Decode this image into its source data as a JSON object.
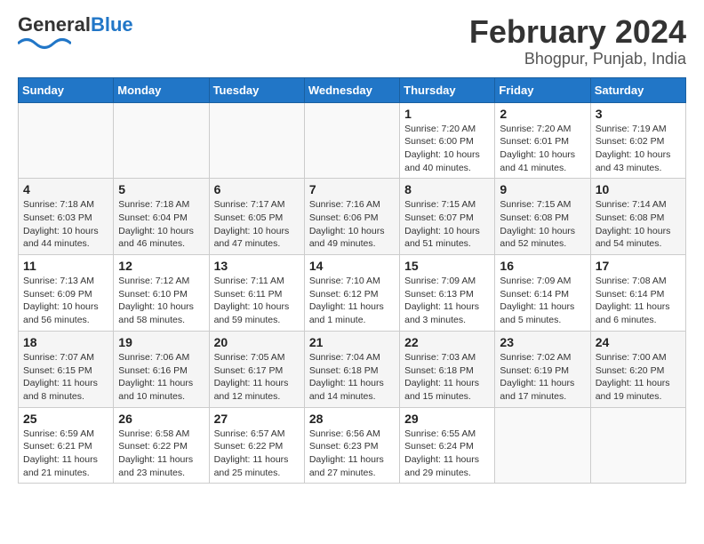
{
  "logo": {
    "general": "General",
    "blue": "Blue"
  },
  "title": "February 2024",
  "subtitle": "Bhogpur, Punjab, India",
  "days_of_week": [
    "Sunday",
    "Monday",
    "Tuesday",
    "Wednesday",
    "Thursday",
    "Friday",
    "Saturday"
  ],
  "weeks": [
    [
      {
        "num": "",
        "info": ""
      },
      {
        "num": "",
        "info": ""
      },
      {
        "num": "",
        "info": ""
      },
      {
        "num": "",
        "info": ""
      },
      {
        "num": "1",
        "info": "Sunrise: 7:20 AM\nSunset: 6:00 PM\nDaylight: 10 hours\nand 40 minutes."
      },
      {
        "num": "2",
        "info": "Sunrise: 7:20 AM\nSunset: 6:01 PM\nDaylight: 10 hours\nand 41 minutes."
      },
      {
        "num": "3",
        "info": "Sunrise: 7:19 AM\nSunset: 6:02 PM\nDaylight: 10 hours\nand 43 minutes."
      }
    ],
    [
      {
        "num": "4",
        "info": "Sunrise: 7:18 AM\nSunset: 6:03 PM\nDaylight: 10 hours\nand 44 minutes."
      },
      {
        "num": "5",
        "info": "Sunrise: 7:18 AM\nSunset: 6:04 PM\nDaylight: 10 hours\nand 46 minutes."
      },
      {
        "num": "6",
        "info": "Sunrise: 7:17 AM\nSunset: 6:05 PM\nDaylight: 10 hours\nand 47 minutes."
      },
      {
        "num": "7",
        "info": "Sunrise: 7:16 AM\nSunset: 6:06 PM\nDaylight: 10 hours\nand 49 minutes."
      },
      {
        "num": "8",
        "info": "Sunrise: 7:15 AM\nSunset: 6:07 PM\nDaylight: 10 hours\nand 51 minutes."
      },
      {
        "num": "9",
        "info": "Sunrise: 7:15 AM\nSunset: 6:08 PM\nDaylight: 10 hours\nand 52 minutes."
      },
      {
        "num": "10",
        "info": "Sunrise: 7:14 AM\nSunset: 6:08 PM\nDaylight: 10 hours\nand 54 minutes."
      }
    ],
    [
      {
        "num": "11",
        "info": "Sunrise: 7:13 AM\nSunset: 6:09 PM\nDaylight: 10 hours\nand 56 minutes."
      },
      {
        "num": "12",
        "info": "Sunrise: 7:12 AM\nSunset: 6:10 PM\nDaylight: 10 hours\nand 58 minutes."
      },
      {
        "num": "13",
        "info": "Sunrise: 7:11 AM\nSunset: 6:11 PM\nDaylight: 10 hours\nand 59 minutes."
      },
      {
        "num": "14",
        "info": "Sunrise: 7:10 AM\nSunset: 6:12 PM\nDaylight: 11 hours\nand 1 minute."
      },
      {
        "num": "15",
        "info": "Sunrise: 7:09 AM\nSunset: 6:13 PM\nDaylight: 11 hours\nand 3 minutes."
      },
      {
        "num": "16",
        "info": "Sunrise: 7:09 AM\nSunset: 6:14 PM\nDaylight: 11 hours\nand 5 minutes."
      },
      {
        "num": "17",
        "info": "Sunrise: 7:08 AM\nSunset: 6:14 PM\nDaylight: 11 hours\nand 6 minutes."
      }
    ],
    [
      {
        "num": "18",
        "info": "Sunrise: 7:07 AM\nSunset: 6:15 PM\nDaylight: 11 hours\nand 8 minutes."
      },
      {
        "num": "19",
        "info": "Sunrise: 7:06 AM\nSunset: 6:16 PM\nDaylight: 11 hours\nand 10 minutes."
      },
      {
        "num": "20",
        "info": "Sunrise: 7:05 AM\nSunset: 6:17 PM\nDaylight: 11 hours\nand 12 minutes."
      },
      {
        "num": "21",
        "info": "Sunrise: 7:04 AM\nSunset: 6:18 PM\nDaylight: 11 hours\nand 14 minutes."
      },
      {
        "num": "22",
        "info": "Sunrise: 7:03 AM\nSunset: 6:18 PM\nDaylight: 11 hours\nand 15 minutes."
      },
      {
        "num": "23",
        "info": "Sunrise: 7:02 AM\nSunset: 6:19 PM\nDaylight: 11 hours\nand 17 minutes."
      },
      {
        "num": "24",
        "info": "Sunrise: 7:00 AM\nSunset: 6:20 PM\nDaylight: 11 hours\nand 19 minutes."
      }
    ],
    [
      {
        "num": "25",
        "info": "Sunrise: 6:59 AM\nSunset: 6:21 PM\nDaylight: 11 hours\nand 21 minutes."
      },
      {
        "num": "26",
        "info": "Sunrise: 6:58 AM\nSunset: 6:22 PM\nDaylight: 11 hours\nand 23 minutes."
      },
      {
        "num": "27",
        "info": "Sunrise: 6:57 AM\nSunset: 6:22 PM\nDaylight: 11 hours\nand 25 minutes."
      },
      {
        "num": "28",
        "info": "Sunrise: 6:56 AM\nSunset: 6:23 PM\nDaylight: 11 hours\nand 27 minutes."
      },
      {
        "num": "29",
        "info": "Sunrise: 6:55 AM\nSunset: 6:24 PM\nDaylight: 11 hours\nand 29 minutes."
      },
      {
        "num": "",
        "info": ""
      },
      {
        "num": "",
        "info": ""
      }
    ]
  ]
}
